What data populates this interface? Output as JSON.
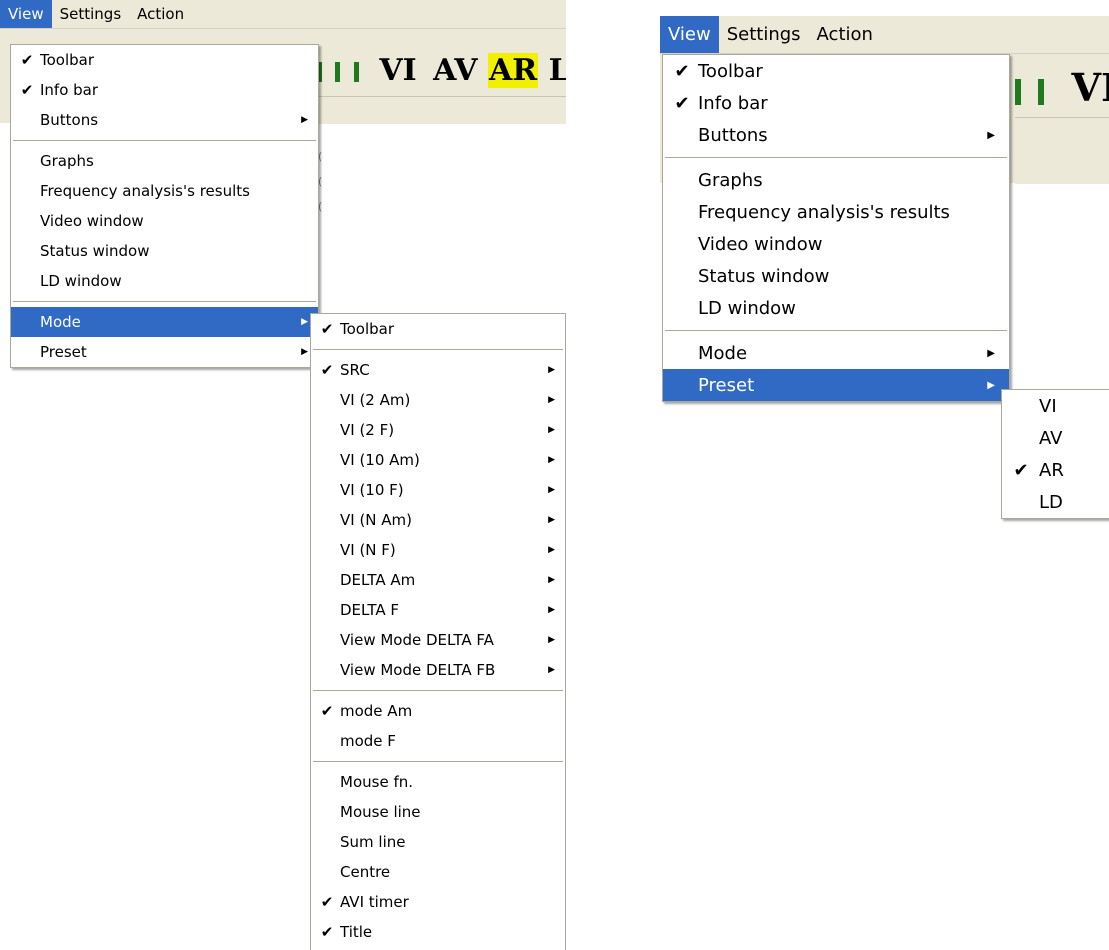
{
  "colors": {
    "highlight": "#316ac5",
    "menubar": "#ece9d8",
    "toolbar_green": "#1f7a1f",
    "toolbar_yellow": "#f0f000"
  },
  "left": {
    "menubar": [
      "View",
      "Settings",
      "Action"
    ],
    "toolbar_text": {
      "vi": "VI",
      "av": "AV",
      "ar": "AR",
      "ld": "LI"
    },
    "view_menu": {
      "group1": [
        {
          "label": "Toolbar",
          "checked": true
        },
        {
          "label": "Info bar",
          "checked": true
        },
        {
          "label": "Buttons",
          "submenu": true
        }
      ],
      "group2": [
        "Graphs",
        "Frequency analysis's results",
        "Video window",
        "Status window",
        "LD window"
      ],
      "group3": [
        {
          "label": "Mode",
          "submenu": true,
          "highlighted": true
        },
        {
          "label": "Preset",
          "submenu": true
        }
      ]
    },
    "mode_menu": {
      "group1": [
        {
          "label": "Toolbar",
          "checked": true
        }
      ],
      "group2": [
        {
          "label": "SRC",
          "checked": true
        },
        {
          "label": "VI (2 Am)"
        },
        {
          "label": "VI (2 F)"
        },
        {
          "label": "VI (10 Am)"
        },
        {
          "label": "VI (10 F)"
        },
        {
          "label": "VI (N Am)"
        },
        {
          "label": "VI (N F)"
        },
        {
          "label": "DELTA Am"
        },
        {
          "label": "DELTA F"
        },
        {
          "label": "View Mode DELTA FA"
        },
        {
          "label": "View Mode DELTA FB"
        }
      ],
      "group3": [
        {
          "label": "mode Am",
          "checked": true
        },
        {
          "label": "mode F"
        }
      ],
      "group4": [
        {
          "label": "Mouse fn."
        },
        {
          "label": "Mouse line"
        },
        {
          "label": "Sum line"
        },
        {
          "label": "Centre"
        },
        {
          "label": "AVI timer",
          "checked": true
        },
        {
          "label": "Title",
          "checked": true
        }
      ]
    }
  },
  "right": {
    "menubar": [
      "View",
      "Settings",
      "Action"
    ],
    "toolbar_text": {
      "vi": "VI"
    },
    "view_menu": {
      "group1": [
        {
          "label": "Toolbar",
          "checked": true
        },
        {
          "label": "Info bar",
          "checked": true
        },
        {
          "label": "Buttons",
          "submenu": true
        }
      ],
      "group2": [
        "Graphs",
        "Frequency analysis's results",
        "Video window",
        "Status window",
        "LD window"
      ],
      "group3": [
        {
          "label": "Mode",
          "submenu": true
        },
        {
          "label": "Preset",
          "submenu": true,
          "highlighted": true
        }
      ]
    },
    "preset_menu": [
      {
        "label": "VI"
      },
      {
        "label": "AV"
      },
      {
        "label": "AR",
        "checked": true
      },
      {
        "label": "LD"
      }
    ]
  },
  "glyphs": {
    "check": "✔",
    "arrow": "▶"
  }
}
